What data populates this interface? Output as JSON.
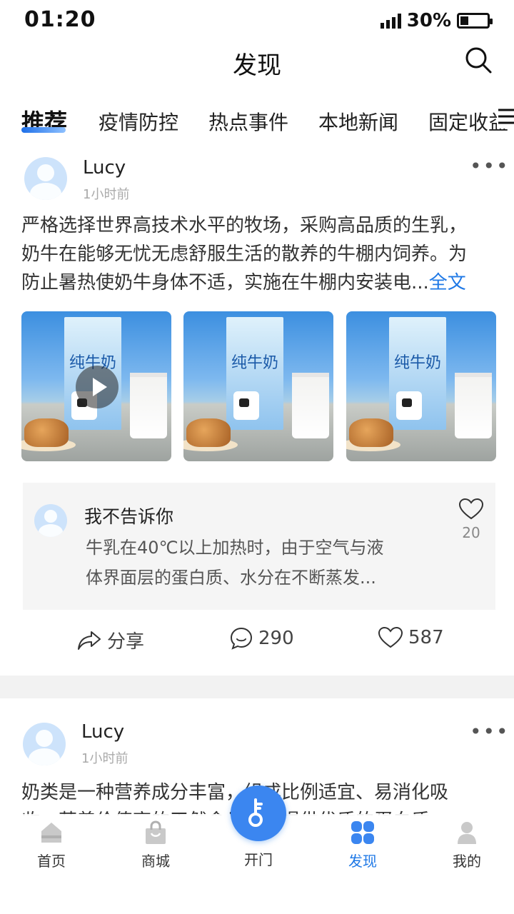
{
  "status_bar": {
    "time": "01:20",
    "battery": "30%",
    "battery_level": 0.3
  },
  "header": {
    "title": "发现"
  },
  "tabs": [
    "推荐",
    "疫情防控",
    "热点事件",
    "本地新闻",
    "固定收益"
  ],
  "posts": [
    {
      "user": "Lucy",
      "time": "1小时前",
      "text_lines": [
        "严格选择世界高技术水平的牧场，采购高品质的生乳，",
        "奶牛在能够无忧无虑舒服生活的散养的牛棚内饲养。为",
        "防止暑热使奶牛身体不适，实施在牛棚内安装电..."
      ],
      "full_text_link": "全文",
      "media_product_text": "纯牛奶",
      "comment": {
        "user": "我不告诉你",
        "text_lines": [
          "牛乳在40℃以上加热时，由于空气与液",
          "体界面层的蛋白质、水分在不断蒸发..."
        ],
        "likes": "20"
      },
      "actions": {
        "share": "分享",
        "comments": "290",
        "likes": "587"
      }
    },
    {
      "user": "Lucy",
      "time": "1小时前",
      "text_lines": [
        "奶类是一种营养成分丰富，组成比例适宜、易消化吸",
        "收、营养价值高的天然食品，能提供优质的蛋白质"
      ]
    }
  ],
  "bottom_nav": [
    {
      "label": "首页",
      "icon": "home-icon"
    },
    {
      "label": "商城",
      "icon": "shop-bag-icon"
    },
    {
      "label": "开门",
      "icon": "open-door-icon"
    },
    {
      "label": "发现",
      "icon": "discover-grid-icon"
    },
    {
      "label": "我的",
      "icon": "profile-icon"
    }
  ],
  "colors": {
    "accent": "#1e78e6",
    "fab": "#3b86f0"
  }
}
